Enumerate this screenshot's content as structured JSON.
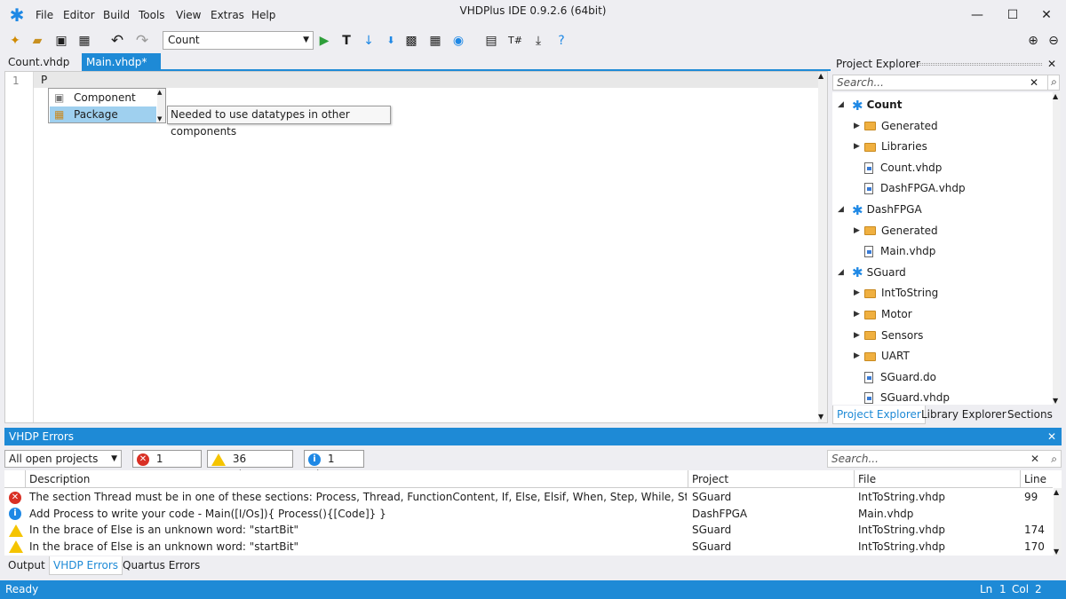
{
  "window": {
    "title": "VHDPlus IDE 0.9.2.6 (64bit)"
  },
  "menu": [
    "File",
    "Editor",
    "Build",
    "Tools",
    "View",
    "Extras",
    "Help"
  ],
  "toolbar": {
    "config_value": "Count"
  },
  "editor_tabs": [
    {
      "label": "Count.vhdp",
      "active": false
    },
    {
      "label": "Main.vhdp*",
      "active": true
    }
  ],
  "editor": {
    "line_number": "1",
    "line_text": "P"
  },
  "completion": {
    "items": [
      "Component",
      "Package"
    ],
    "tooltip": "Needed to use datatypes in other components"
  },
  "explorer": {
    "title": "Project Explorer",
    "search_placeholder": "Search...",
    "tree": [
      {
        "level": 0,
        "type": "project",
        "label": "Count",
        "bold": true
      },
      {
        "level": 1,
        "type": "folder",
        "label": "Generated"
      },
      {
        "level": 1,
        "type": "folder",
        "label": "Libraries"
      },
      {
        "level": 1,
        "type": "file",
        "label": "Count.vhdp"
      },
      {
        "level": 1,
        "type": "file",
        "label": "DashFPGA.vhdp"
      },
      {
        "level": 0,
        "type": "project",
        "label": "DashFPGA"
      },
      {
        "level": 1,
        "type": "folder",
        "label": "Generated"
      },
      {
        "level": 1,
        "type": "file",
        "label": "Main.vhdp"
      },
      {
        "level": 0,
        "type": "project",
        "label": "SGuard"
      },
      {
        "level": 1,
        "type": "folder",
        "label": "IntToString"
      },
      {
        "level": 1,
        "type": "folder",
        "label": "Motor"
      },
      {
        "level": 1,
        "type": "folder",
        "label": "Sensors"
      },
      {
        "level": 1,
        "type": "folder",
        "label": "UART"
      },
      {
        "level": 1,
        "type": "file",
        "label": "SGuard.do"
      },
      {
        "level": 1,
        "type": "file",
        "label": "SGuard.vhdp"
      }
    ],
    "tabs": [
      "Project Explorer",
      "Library Explorer",
      "Sections"
    ]
  },
  "errors": {
    "title": "VHDP Errors",
    "filter_value": "All open projects",
    "errors_label": "1 Errors",
    "warnings_label": "36 Warnings",
    "hints_label": "1 Hints",
    "search_placeholder": "Search...",
    "columns": [
      "Description",
      "Project",
      "File",
      "Line"
    ],
    "rows": [
      {
        "severity": "error",
        "description": "The section Thread must be in one of these sections: Process, Thread, FunctionContent, If, Else, Elsif, When, Step, While, StepIf, StepElsif, Step",
        "project": "SGuard",
        "file": "IntToString.vhdp",
        "line": "99"
      },
      {
        "severity": "hint",
        "description": "Add Process to write your code - Main([I/Os]){ Process(){[Code]} }",
        "project": "DashFPGA",
        "file": "Main.vhdp",
        "line": ""
      },
      {
        "severity": "warning",
        "description": "In the brace of Else  is an unknown word: \"startBit\"",
        "project": "SGuard",
        "file": "IntToString.vhdp",
        "line": "174"
      },
      {
        "severity": "warning",
        "description": "In the brace of Else  is an unknown word: \"startBit\"",
        "project": "SGuard",
        "file": "IntToString.vhdp",
        "line": "170"
      }
    ]
  },
  "bottom_tabs": [
    "Output",
    "VHDP Errors",
    "Quartus Errors"
  ],
  "status": {
    "left": "Ready",
    "ln_label": "Ln",
    "ln": "1",
    "col_label": "Col",
    "col": "2"
  },
  "colors": {
    "accent": "#1e8ad6",
    "selection": "#9fd0ef",
    "error": "#d93025",
    "warning": "#f5c400",
    "hint": "#1e88e5"
  }
}
